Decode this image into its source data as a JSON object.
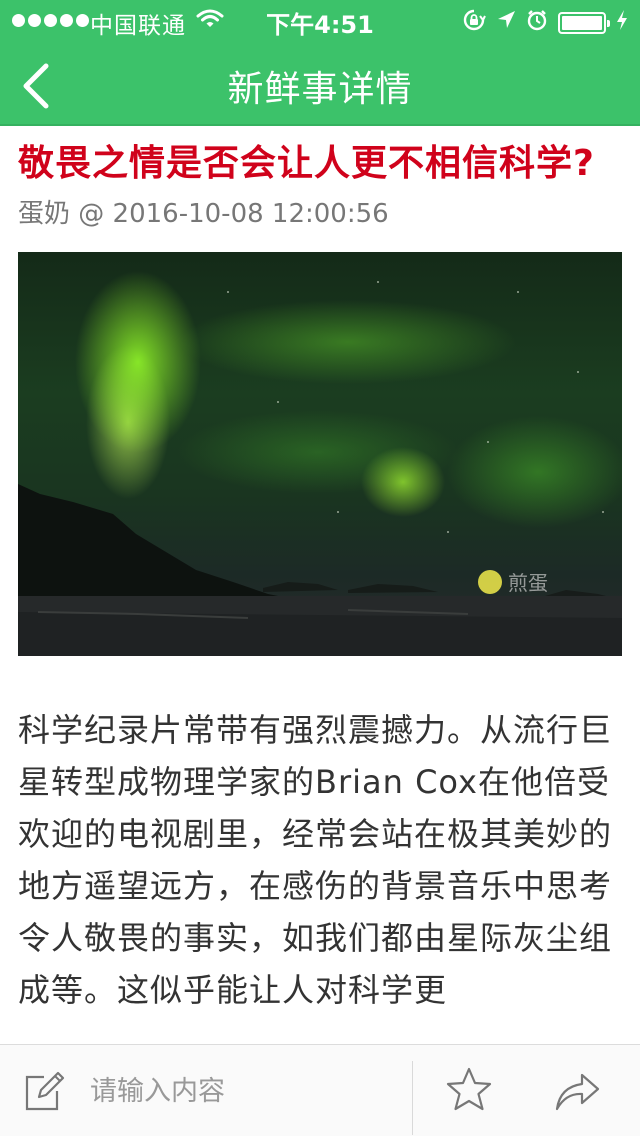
{
  "status_bar": {
    "carrier": "中国联通",
    "time": "下午4:51",
    "signal_bars": 5,
    "battery_level": 1.0,
    "icons": [
      "signal-icon",
      "wifi-icon",
      "rotation-lock-icon",
      "location-icon",
      "alarm-icon",
      "battery-icon",
      "charging-icon"
    ]
  },
  "nav": {
    "title": "新鲜事详情",
    "back_icon": "chevron-left-icon"
  },
  "article": {
    "title": "敬畏之情是否会让人更不相信科学?",
    "author": "蛋奶",
    "at": "@",
    "datetime": "2016-10-08 12:00:56",
    "image_subject": "aurora-borealis-photo",
    "image_watermark": "煎蛋",
    "body": "科学纪录片常带有强烈震撼力。从流行巨星转型成物理学家的Brian Cox在他倍受欢迎的电视剧里，经常会站在极其美妙的地方遥望远方，在感伤的背景音乐中思考令人敬畏的事实，如我们都由星际灰尘组成等。这似乎能让人对科学更"
  },
  "toolbar": {
    "comment_placeholder": "请输入内容",
    "compose_icon": "compose-icon",
    "star_icon": "star-icon",
    "share_icon": "share-icon"
  },
  "colors": {
    "header_green": "#3cc26a",
    "title_red": "#d0021b",
    "meta_gray": "#777777",
    "body_text": "#333333"
  }
}
